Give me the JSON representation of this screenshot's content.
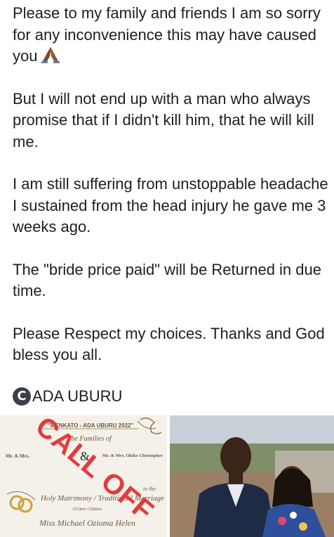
{
  "post": {
    "paragraphs": [
      "Please to my family and friends I am so sorry for any inconvenience this may have caused you",
      "But I will not end up with a man who always promise that if I didn't kill him, that he will kill me.",
      "I am still suffering from unstoppable headache I sustained from the head injury he gave me 3 weeks ago.",
      "The \"bride price paid\" will be Returned in due time.",
      "Please Respect my choices. Thanks and God bless you all."
    ],
    "credit": "ADA UBURU",
    "copyright_symbol": "C",
    "pray_emoji_icon": "folded-hands-icon"
  },
  "invitation": {
    "header": "\"MENKATO - ADA UBURU 2022\"",
    "families_line": "The Families of",
    "left_family": "Mr. & Mrs.",
    "right_family": "Mr. & Mrs. Okike Christopher",
    "ampersand": "&",
    "matrimony_line": "Holy Matrimony / Traditional Marriage",
    "to_the": "to the",
    "of_their_children": "Of their Children",
    "bride_name": "Miss Michael Ozioma Helen",
    "stamp": "CALL OFF"
  },
  "colors": {
    "text": "#1c1e21",
    "stamp_red": "#e23b3b",
    "card_bg": "#f4f1ea"
  }
}
